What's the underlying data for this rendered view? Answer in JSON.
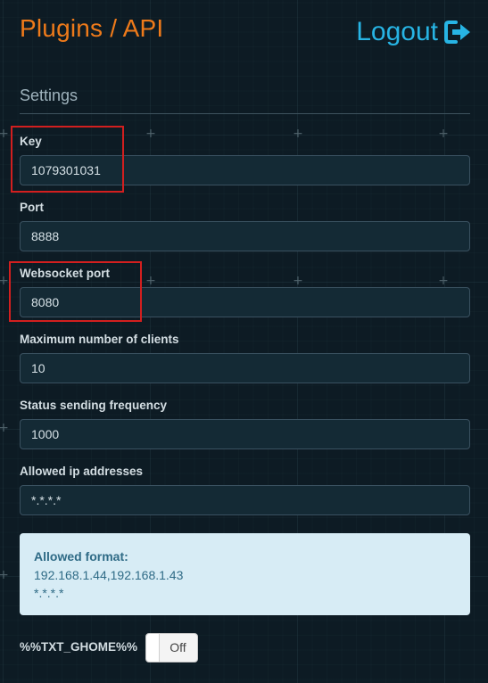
{
  "header": {
    "title": "Plugins / API",
    "logout_label": "Logout"
  },
  "settings": {
    "title": "Settings",
    "fields": [
      {
        "label": "Key",
        "value": "1079301031"
      },
      {
        "label": "Port",
        "value": "8888"
      },
      {
        "label": "Websocket port",
        "value": "8080"
      },
      {
        "label": "Maximum number of clients",
        "value": "10"
      },
      {
        "label": "Status sending frequency",
        "value": "1000"
      },
      {
        "label": "Allowed ip addresses",
        "value": "*.*.*.*"
      }
    ],
    "info": {
      "title": "Allowed format:",
      "lines": [
        "192.168.1.44,192.168.1.43",
        "*.*.*.*"
      ]
    },
    "toggle": {
      "label": "%%TXT_GHOME%%",
      "state": "Off"
    }
  },
  "colors": {
    "title": "#ee7a1a",
    "logout": "#27b4e4",
    "highlight": "#d21f1f",
    "info_bg": "#d7ecf5"
  },
  "icons": {
    "logout": "logout-icon",
    "background": "plus-grid-icon"
  }
}
